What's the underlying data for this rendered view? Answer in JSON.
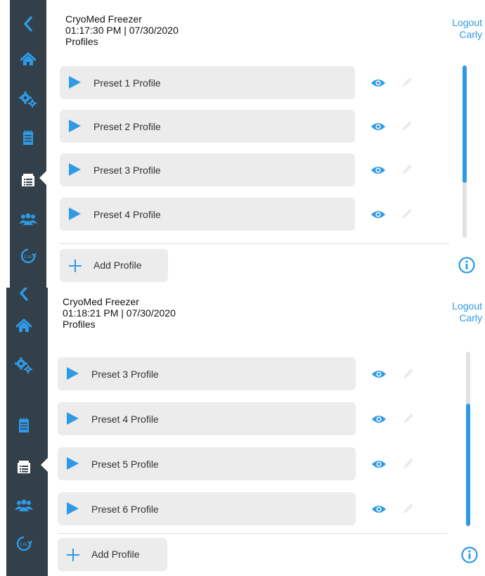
{
  "colors": {
    "accent": "#2e9ae6",
    "sidebar": "#334049",
    "row_bg": "#ececec"
  },
  "sidebar": {
    "icons": [
      "back-chevron-icon",
      "home-icon",
      "gears-icon",
      "notepad-icon",
      "profiles-icon",
      "users-icon",
      "calibration-icon"
    ],
    "active": "profiles-icon"
  },
  "panels": [
    {
      "device_name": "CryoMed Freezer",
      "datetime": "01:17:30 PM | 07/30/2020",
      "section": "Profiles",
      "logout_label": "Logout",
      "user_name": "Carly",
      "profiles": [
        {
          "label": "Preset 1 Profile"
        },
        {
          "label": "Preset 2 Profile"
        },
        {
          "label": "Preset 3 Profile"
        },
        {
          "label": "Preset 4 Profile"
        }
      ],
      "add_label": "Add Profile",
      "scroll_position_fraction": 0.0
    },
    {
      "device_name": "CryoMed Freezer",
      "datetime": "01:18:21 PM | 07/30/2020",
      "section": "Profiles",
      "logout_label": "Logout",
      "user_name": "Carly",
      "profiles": [
        {
          "label": "Preset 3 Profile"
        },
        {
          "label": "Preset 4 Profile"
        },
        {
          "label": "Preset 5 Profile"
        },
        {
          "label": "Preset 6 Profile"
        }
      ],
      "add_label": "Add Profile",
      "scroll_position_fraction": 1.0
    }
  ]
}
